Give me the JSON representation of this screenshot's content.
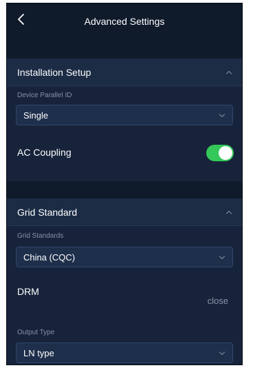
{
  "header": {
    "title": "Advanced Settings",
    "back_icon": "chevron-left-icon"
  },
  "installation_setup": {
    "title": "Installation Setup",
    "collapse_icon": "chevron-up-icon",
    "device_parallel_id": {
      "label": "Device Parallel ID",
      "value": "Single"
    },
    "ac_coupling": {
      "label": "AC Coupling",
      "enabled": true
    }
  },
  "grid_standard": {
    "title": "Grid Standard",
    "collapse_icon": "chevron-up-icon",
    "grid_standards": {
      "label": "Grid Standards",
      "value": "China (CQC)"
    },
    "drm": {
      "label": "DRM",
      "value": "close"
    },
    "output_type": {
      "label": "Output Type",
      "value": "LN type"
    }
  },
  "colors": {
    "background": "#16233a",
    "navbar": "#0f1a2b",
    "section_header": "#1c2c45",
    "input_bg": "#1e2f4b",
    "toggle_on": "#34c759"
  }
}
